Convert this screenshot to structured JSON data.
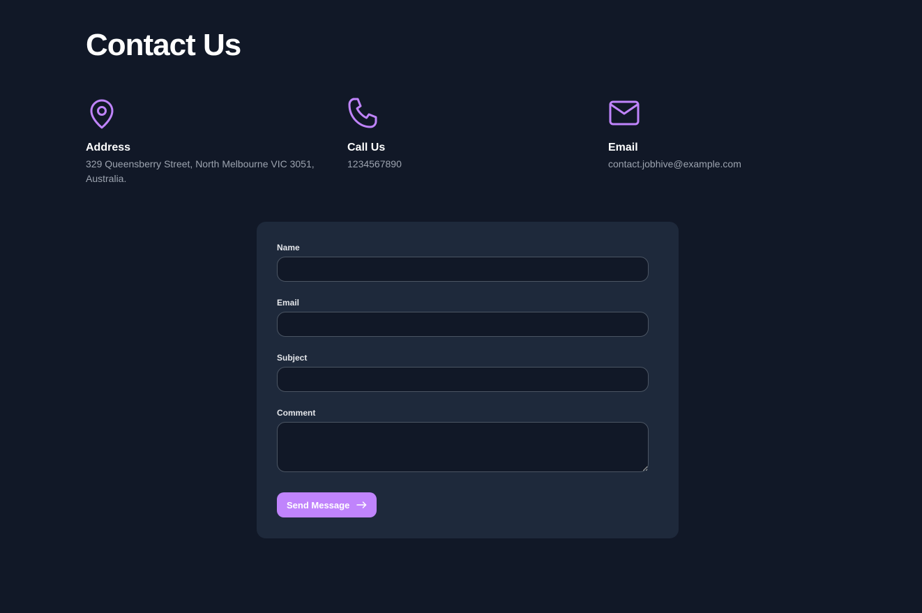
{
  "page": {
    "title": "Contact Us"
  },
  "info": {
    "address": {
      "icon": "map-pin-icon",
      "title": "Address",
      "text": "329 Queensberry Street, North Melbourne VIC 3051, Australia."
    },
    "phone": {
      "icon": "phone-icon",
      "title": "Call Us",
      "text": "1234567890"
    },
    "email": {
      "icon": "mail-icon",
      "title": "Email",
      "text": "contact.jobhive@example.com"
    }
  },
  "form": {
    "name_label": "Name",
    "name_value": "",
    "email_label": "Email",
    "email_value": "",
    "subject_label": "Subject",
    "subject_value": "",
    "comment_label": "Comment",
    "comment_value": "",
    "submit_label": "Send Message",
    "submit_icon": "arrow-right-icon"
  },
  "colors": {
    "background": "#111827",
    "card": "#1e293b",
    "accent": "#c084fc",
    "muted_text": "#9ca3af"
  }
}
